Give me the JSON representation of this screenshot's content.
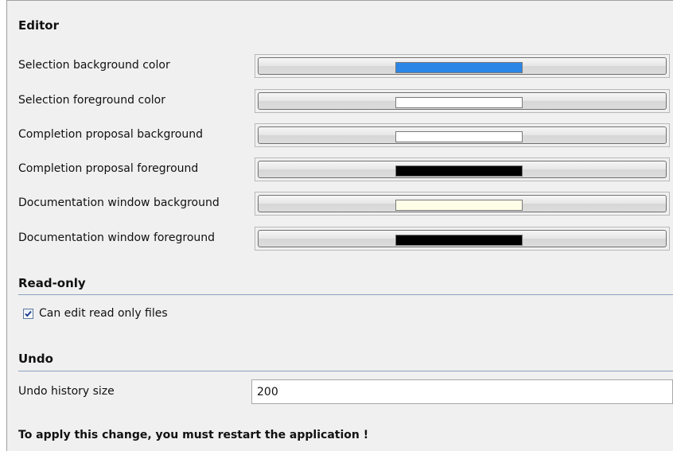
{
  "editor": {
    "title": "Editor",
    "color_rows": [
      {
        "label": "Selection background color",
        "color": "#2b86e6"
      },
      {
        "label": "Selection foreground color",
        "color": "#ffffff"
      },
      {
        "label": "Completion proposal background",
        "color": "#ffffff"
      },
      {
        "label": "Completion proposal foreground",
        "color": "#000000"
      },
      {
        "label": "Documentation window background",
        "color": "#fdfde8"
      },
      {
        "label": "Documentation window foreground",
        "color": "#000000"
      }
    ]
  },
  "read_only": {
    "title": "Read-only",
    "checkbox_label": "Can edit read only files",
    "checked": true
  },
  "undo": {
    "title": "Undo",
    "history_label": "Undo history size",
    "history_value": "200"
  },
  "notice": "To apply this change, you must restart the application !"
}
